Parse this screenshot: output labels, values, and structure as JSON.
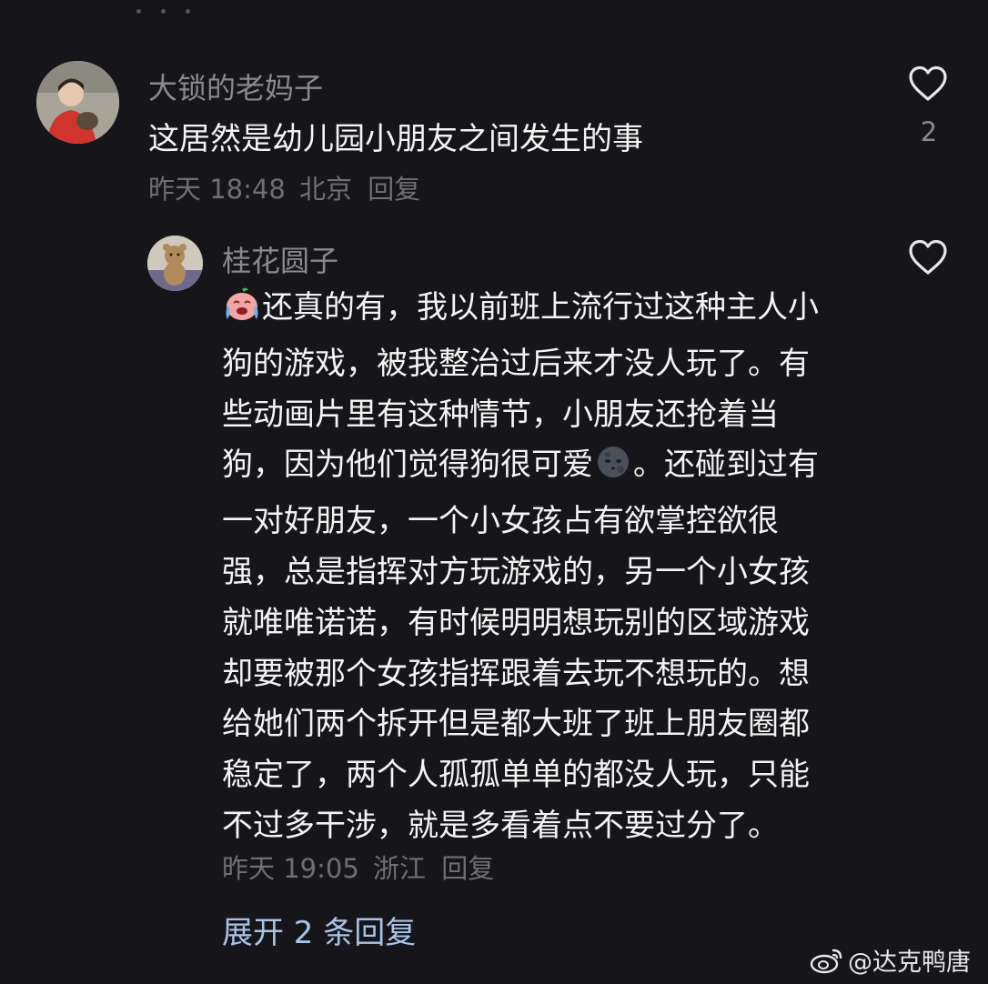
{
  "comment1": {
    "username": "大锁的老妈子",
    "text": "这居然是幼儿园小朋友之间发生的事",
    "time": "昨天 18:48",
    "location": "北京",
    "reply_label": "回复",
    "like_count": "2"
  },
  "comment2": {
    "username": "桂花圆子",
    "text_line1_after_emoji": "还真的有，我以前班上流行过这种主人小",
    "text_line2": "狗的游戏，被我整治过后来才没人玩了。有",
    "text_line3": "些动画片里有这种情节，小朋友还抢着当",
    "text_line4_before_emoji": "狗，因为他们觉得狗很可爱",
    "text_line4_after_emoji": "。还碰到过有",
    "text_line5": "一对好朋友，一个小女孩占有欲掌控欲很",
    "text_line6": "强，总是指挥对方玩游戏的，另一个小女孩",
    "text_line7": "就唯唯诺诺，有时候明明想玩别的区域游戏",
    "text_line8": "却要被那个女孩指挥跟着去玩不想玩的。想",
    "text_line9": "给她们两个拆开但是都大班了班上朋友圈都",
    "text_line10": "稳定了，两个人孤孤单单的都没人玩，只能",
    "text_line11": "不过多干涉，就是多看着点不要过分了。",
    "time": "昨天 19:05",
    "location": "浙江",
    "reply_label": "回复"
  },
  "expand_replies": "展开 2 条回复",
  "watermark": "@达克鸭唐",
  "icons": {
    "like": "heart-outline-icon",
    "emoji1": "crying-face-emoji-icon",
    "emoji2": "new-moon-face-emoji-icon",
    "watermark_logo": "weibo-logo-icon"
  },
  "colors": {
    "background": "#16161a",
    "username": "#8a8a8e",
    "text": "#f4f4f4",
    "meta": "#6f6f74",
    "link": "#a9c3e8"
  }
}
